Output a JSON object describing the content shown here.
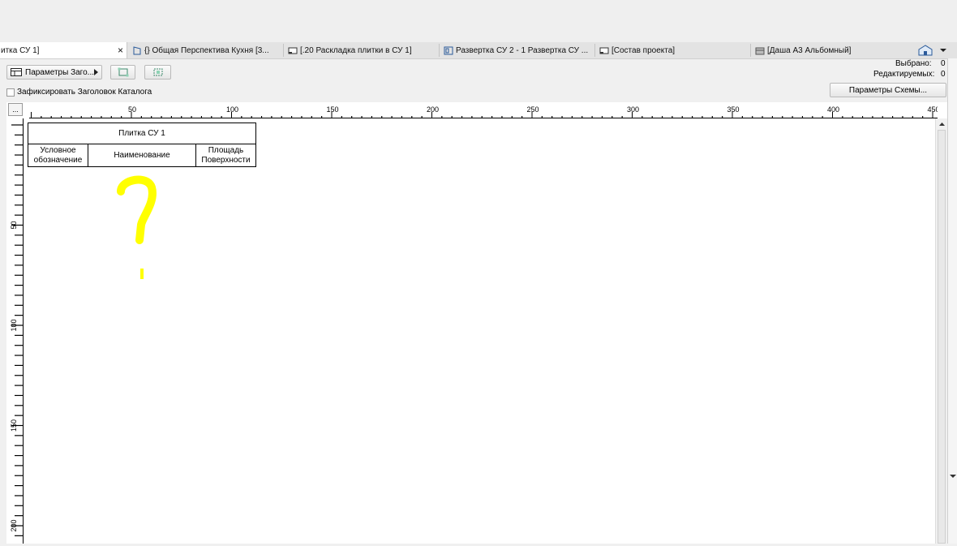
{
  "tabs": [
    {
      "label": "итка СУ 1]",
      "active": true
    },
    {
      "label": "{} Общая Перспектива Кухня [3..."
    },
    {
      "label": "[.20 Раскладка плитки в СУ 1]"
    },
    {
      "label": "Развертка СУ 2 - 1 Развертка СУ ..."
    },
    {
      "label": "[Состав проекта]"
    },
    {
      "label": "[Даша А3 Альбомный]"
    }
  ],
  "tab_close_glyph": "×",
  "toolbar": {
    "header_params_label": "Параметры Заго...",
    "fix_header_label": "Зафиксировать Заголовок Каталога",
    "schema_params_label": "Параметры Схемы...",
    "ruler_corner_label": "..."
  },
  "status": {
    "selected_label": "Выбрано:",
    "selected_value": "0",
    "editable_label": "Редактируемых:",
    "editable_value": "0"
  },
  "ruler": {
    "h_labels": [
      "50",
      "100",
      "150",
      "200",
      "250",
      "300",
      "350",
      "400",
      "450"
    ],
    "v_labels": [
      "50",
      "100",
      "150",
      "200"
    ]
  },
  "schedule": {
    "title": "Плитка СУ 1",
    "columns": [
      "Условное обозначение",
      "Наименование",
      "Площадь Поверхности"
    ]
  },
  "annotation": {
    "glyph": "?",
    "color": "#ffff00"
  }
}
